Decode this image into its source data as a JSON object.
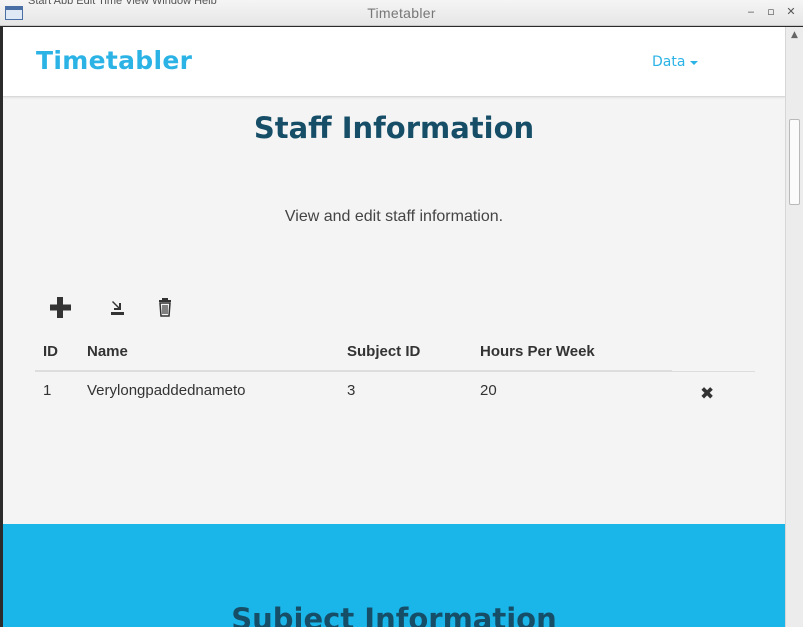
{
  "window": {
    "title": "Timetabler",
    "menu_strip": "Start  App  Edit  Time  View  Window  Help",
    "controls": {
      "minimize": "‒",
      "maximize": "▫",
      "close": "✕"
    }
  },
  "navbar": {
    "brand": "Timetabler",
    "dropdown_label": "Data"
  },
  "staff_section": {
    "title": "Staff Information",
    "subtitle": "View and edit staff information.",
    "toolbar": {
      "add_icon": "plus-icon",
      "import_icon": "import-icon",
      "delete_icon": "trash-icon"
    },
    "table": {
      "headers": [
        "ID",
        "Name",
        "Subject ID",
        "Hours Per Week"
      ],
      "rows": [
        {
          "id": "1",
          "name": "Verylongpaddednameto",
          "subject_id": "3",
          "hours_per_week": "20",
          "remove": "✖"
        }
      ]
    }
  },
  "subject_section": {
    "title": "Subject Information"
  },
  "colors": {
    "accent": "#2bb3e6",
    "heading": "#164e68",
    "section_blue": "#1ab6ea",
    "page_bg": "#f4f4f4"
  }
}
